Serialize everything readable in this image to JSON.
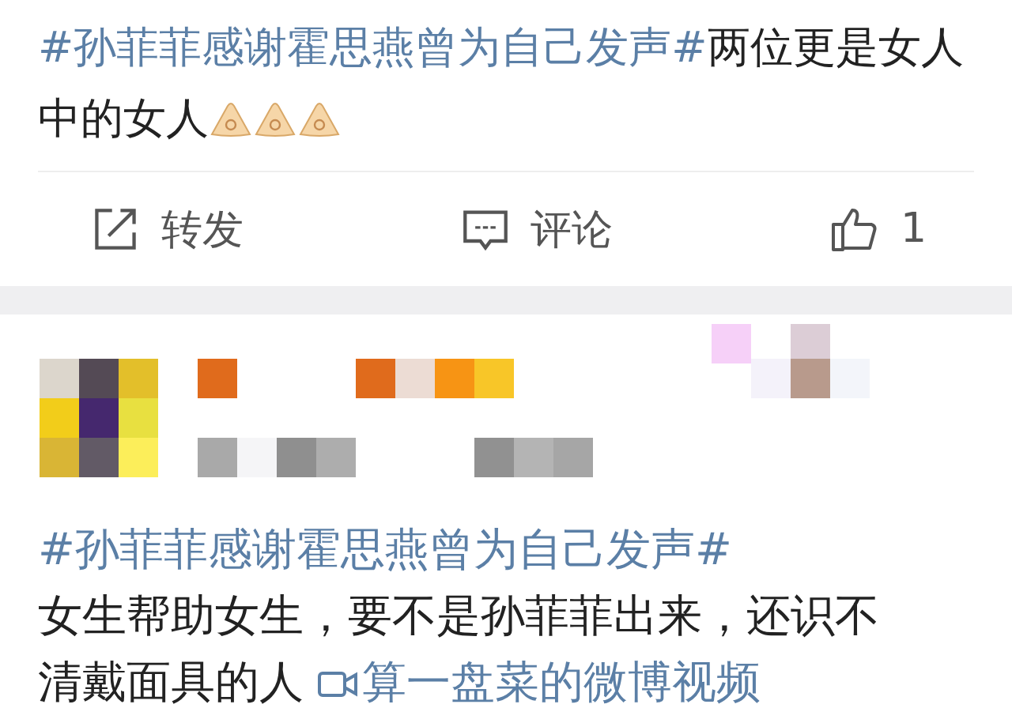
{
  "post": {
    "topic": "#孙菲菲感谢霍思燕曾为自己发声#",
    "text": "两位更是女人中的女人"
  },
  "actions": [
    {
      "kind": "repost",
      "label": "转发"
    },
    {
      "kind": "comment",
      "label": "评论"
    },
    {
      "kind": "like",
      "label": "1"
    }
  ],
  "comment": {
    "topic": "#孙菲菲感谢霍思燕曾为自己发声#",
    "text": "女生帮助女生，要不是孙菲菲出来，还识不清戴面具的人",
    "video_link": "算一盘菜的微博视频"
  }
}
